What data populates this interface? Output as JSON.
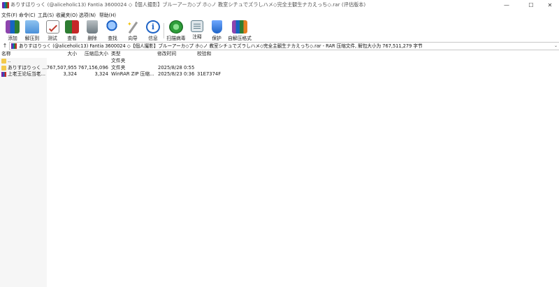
{
  "window": {
    "title": "ありすほりっく (@aliceholic13) Fantia 3600024 ◇【個人撮影】ブルーアーカ◇プ ホ◇ノ 教室シチュでズラしハメ◇完全主観生ナカえっち◇.rar (评估版本)",
    "minimize": "—",
    "maximize": "☐",
    "close": "✕"
  },
  "menu": [
    "文件(F)",
    "命令(C)",
    "工具(S)",
    "收藏夹(O)",
    "选项(N)",
    "帮助(H)"
  ],
  "toolbar": [
    {
      "label": "添加",
      "icon": "add-archive-icon",
      "color": "#8e44ad"
    },
    {
      "label": "解压到",
      "icon": "extract-folder-icon",
      "color": "#4a90d9"
    },
    {
      "label": "测试",
      "icon": "test-checklist-icon",
      "color": "#c0392b"
    },
    {
      "label": "查看",
      "icon": "view-book-icon",
      "color": "#2e7d32"
    },
    {
      "label": "删除",
      "icon": "trash-icon",
      "color": "#7f8c8d"
    },
    {
      "label": "查找",
      "icon": "magnifier-icon",
      "color": "#1e63c6"
    },
    {
      "label": "向导",
      "icon": "wand-icon",
      "color": "#b0b0b0"
    },
    {
      "label": "信息",
      "icon": "info-icon",
      "color": "#1e63c6"
    },
    {
      "label": "扫描病毒",
      "icon": "virus-scan-icon",
      "color": "#2e9d3a"
    },
    {
      "label": "注释",
      "icon": "comment-icon",
      "color": "#607d8b"
    },
    {
      "label": "保护",
      "icon": "shield-icon",
      "color": "#1e63c6"
    },
    {
      "label": "自解压格式",
      "icon": "sfx-archive-icon",
      "color": "#e67e22"
    }
  ],
  "path": {
    "up": "↑",
    "text": "ありすほりっく (@aliceholic13) Fantia 3600024 ◇【個人撮影】ブルーアーカ◇プ ホ◇ノ 教室シチュでズラしハメ◇完全主観生ナカえっち◇.rar - RAR 压缩文件, 解包大小为 767,511,279 字节",
    "dropdown": "⌄"
  },
  "columns": {
    "name": "名称",
    "size": "大小",
    "packed": "压缩后大小",
    "type": "类型",
    "modified": "修改时间",
    "crc": "校验和"
  },
  "rows": [
    {
      "name": "..",
      "size": "",
      "packed": "",
      "type": "文件夹",
      "modified": "",
      "crc": "",
      "icon": "parent-folder-icon"
    },
    {
      "name": "ありすほりっく ...",
      "size": "767,507,955",
      "packed": "767,156,096",
      "type": "文件夹",
      "modified": "2025/8/28 0:55",
      "crc": "",
      "icon": "folder-icon"
    },
    {
      "name": "上老王论坛当老...",
      "size": "3,324",
      "packed": "3,324",
      "type": "WinRAR ZIP 压缩...",
      "modified": "2025/8/23 0:36",
      "crc": "31E7374F",
      "icon": "zip-archive-icon"
    }
  ]
}
